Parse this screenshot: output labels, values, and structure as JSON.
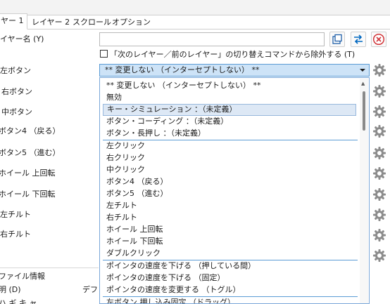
{
  "tabs": [
    {
      "label": "ヤー 1",
      "active": true
    },
    {
      "label": "レイヤー 2",
      "active": false
    },
    {
      "label": "スクロール",
      "active": false
    },
    {
      "label": "オプション",
      "active": false
    }
  ],
  "layer_name": {
    "label": "イヤー名 (Y)",
    "value": ""
  },
  "exclude_checkbox": {
    "label": "「次のレイヤー／前のレイヤー」の切り替えコマンドから除外する (T)",
    "checked": false
  },
  "combo": {
    "selected": "** 変更しない （インターセプトしない） **"
  },
  "rows": [
    {
      "label": "左ボタン"
    },
    {
      "label": "右ボタン"
    },
    {
      "label": "中ボタン"
    },
    {
      "label": "ボタン4 （戻る）"
    },
    {
      "label": "ボタン5 （進む）"
    },
    {
      "label": "ホイール 上回転"
    },
    {
      "label": "ホイール 下回転"
    },
    {
      "label": "左チルト"
    },
    {
      "label": "右チルト"
    }
  ],
  "dropdown_items": [
    {
      "label": "** 変更しない （インターセプトしない） **",
      "highlighted": false
    },
    {
      "label": "無効",
      "highlighted": false
    },
    {
      "label": "キー・シミュレーション ：（未定義）",
      "highlighted": true
    },
    {
      "label": "ボタン・コーディング ：（未定義）",
      "highlighted": false
    },
    {
      "label": "ボタン・長押し ：（未定義）",
      "highlighted": false
    },
    {
      "label": "左クリック",
      "highlighted": false
    },
    {
      "label": "右クリック",
      "highlighted": false
    },
    {
      "label": "中クリック",
      "highlighted": false
    },
    {
      "label": "ボタン4 （戻る）",
      "highlighted": false
    },
    {
      "label": "ボタン5 （進む）",
      "highlighted": false
    },
    {
      "label": "左チルト",
      "highlighted": false
    },
    {
      "label": "右チルト",
      "highlighted": false
    },
    {
      "label": "ホイール 上回転",
      "highlighted": false
    },
    {
      "label": "ホイール 下回転",
      "highlighted": false
    },
    {
      "label": "ダブルクリック",
      "highlighted": false
    },
    {
      "label": "ポインタの速度を下げる （押している間）",
      "highlighted": false
    },
    {
      "label": "ポインタの速度を下げる （固定）",
      "highlighted": false
    },
    {
      "label": "ポインタの速度を変更する （トグル）",
      "highlighted": false
    },
    {
      "label": "左ボタン 押し込み固定 （ドラッグ）",
      "highlighted": false
    }
  ],
  "file_info": {
    "heading": "ファイル情報",
    "desc_label": "明 (D)",
    "desc_value": "デフ",
    "cut_label": "ハ ギ キ ャ"
  },
  "icons": [
    "copy-icon",
    "swap-arrows-icon",
    "close-circle-icon",
    "dropdown-arrow-icon",
    "gear-icon"
  ],
  "colors": {
    "accent": "#0067c0",
    "selection": "#cde3f7",
    "close_red": "#d13438"
  }
}
